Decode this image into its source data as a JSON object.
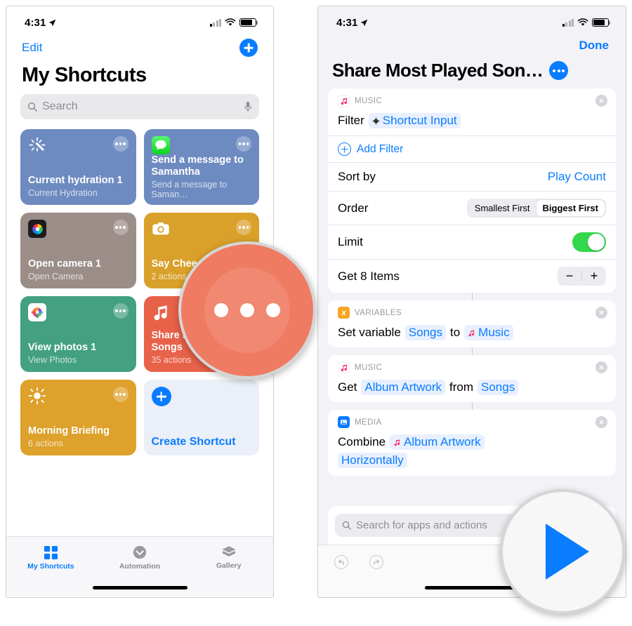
{
  "left_phone": {
    "status": {
      "time": "4:31",
      "location_icon": "location-arrow-icon",
      "signal_icon": "cellular-bars-icon",
      "wifi_icon": "wifi-icon",
      "battery_icon": "battery-icon"
    },
    "nav": {
      "edit_label": "Edit",
      "add_icon": "plus-circle-icon"
    },
    "title": "My Shortcuts",
    "search": {
      "placeholder": "Search",
      "icon": "search-icon",
      "mic_icon": "microphone-icon"
    },
    "cards": [
      {
        "name": "Current hydration 1",
        "sub": "Current Hydration",
        "color": "#6e8bc1",
        "glyph": "sparkle-wand-icon",
        "menu_icon": "ellipsis-icon"
      },
      {
        "name": "Send a message to Samantha",
        "sub": "Send a message to Saman…",
        "color": "#6e8bc1",
        "glyph": "messages-app-icon",
        "menu_icon": "ellipsis-icon"
      },
      {
        "name": "Open camera 1",
        "sub": "Open Camera",
        "color": "#9b8d88",
        "glyph": "camera-app-icon",
        "menu_icon": "ellipsis-icon"
      },
      {
        "name": "Say Cheese",
        "sub": "2 actions",
        "color": "#d9a02a",
        "glyph": "camera-icon",
        "menu_icon": "ellipsis-icon"
      },
      {
        "name": "View photos 1",
        "sub": "View Photos",
        "color": "#43a080",
        "glyph": "photos-app-icon",
        "menu_icon": "ellipsis-icon"
      },
      {
        "name": "Share Most Played Songs",
        "sub": "35 actions",
        "color": "#e8624a",
        "glyph": "music-note-icon",
        "menu_icon": "ellipsis-icon"
      },
      {
        "name": "Morning Briefing",
        "sub": "6 actions",
        "color": "#dda12c",
        "glyph": "sun-icon",
        "menu_icon": "ellipsis-icon"
      }
    ],
    "create_card": {
      "label": "Create Shortcut",
      "icon": "plus-circle-icon",
      "bg": "#eaeff8",
      "accent": "#0a7cff"
    },
    "tabs": [
      {
        "label": "My Shortcuts",
        "icon": "grid-squares-icon",
        "active": true
      },
      {
        "label": "Automation",
        "icon": "clock-automation-icon",
        "active": false
      },
      {
        "label": "Gallery",
        "icon": "layers-icon",
        "active": false
      }
    ]
  },
  "right_phone": {
    "status": {
      "time": "4:31",
      "location_icon": "location-arrow-icon",
      "signal_icon": "cellular-bars-icon",
      "wifi_icon": "wifi-icon",
      "battery_icon": "battery-icon"
    },
    "nav": {
      "done_label": "Done"
    },
    "title": "Share Most Played Son…",
    "title_menu_icon": "ellipsis-circle-icon",
    "action_cards": [
      {
        "category": "MUSIC",
        "icon": "music-app-icon",
        "icon_bg": "#ffffff",
        "close_icon": "close-icon",
        "main_label": "Filter",
        "main_token": "Shortcut Input",
        "token_icon": "shortcut-input-icon",
        "add_filter_label": "Add Filter",
        "add_filter_icon": "plus-circle-outline-icon",
        "rows": [
          {
            "label": "Sort by",
            "value": "Play Count",
            "kind": "link"
          },
          {
            "label": "Order",
            "kind": "segmented",
            "options": [
              "Smallest First",
              "Biggest First"
            ],
            "selected": "Biggest First"
          },
          {
            "label": "Limit",
            "kind": "toggle",
            "on": true
          },
          {
            "label": "Get 8 Items",
            "kind": "stepper",
            "minus": "−",
            "plus": "+"
          }
        ]
      },
      {
        "category": "VARIABLES",
        "icon": "variable-x-icon",
        "icon_bg": "#f5a623",
        "close_icon": "close-icon",
        "segments": [
          {
            "text": "Set variable",
            "type": "plain"
          },
          {
            "text": "Songs",
            "type": "token"
          },
          {
            "text": "to",
            "type": "plain"
          },
          {
            "text": "Music",
            "type": "token",
            "icon": "music-note-icon"
          }
        ]
      },
      {
        "category": "MUSIC",
        "icon": "music-app-icon",
        "icon_bg": "#ffffff",
        "close_icon": "close-icon",
        "segments": [
          {
            "text": "Get",
            "type": "plain"
          },
          {
            "text": "Album Artwork",
            "type": "token"
          },
          {
            "text": "from",
            "type": "plain"
          },
          {
            "text": "Songs",
            "type": "token"
          }
        ]
      },
      {
        "category": "MEDIA",
        "icon": "media-photo-icon",
        "icon_bg": "#0a7cff",
        "close_icon": "close-icon",
        "segments": [
          {
            "text": "Combine",
            "type": "plain"
          },
          {
            "text": "Album Artwork",
            "type": "token",
            "icon": "music-note-icon"
          },
          {
            "text": "Horizontally",
            "type": "token"
          }
        ]
      }
    ],
    "search": {
      "placeholder": "Search for apps and actions",
      "icon": "search-icon"
    },
    "toolbar": {
      "undo_icon": "undo-icon",
      "redo_icon": "redo-icon"
    }
  },
  "callouts": [
    {
      "name": "ellipsis-button-magnifier",
      "kind": "ellipsis",
      "bg": "#ef7b63",
      "dot_color": "#ffffff"
    },
    {
      "name": "play-button-magnifier",
      "kind": "play",
      "bg": "#f7f7f7",
      "tri_color": "#0a7cff"
    }
  ]
}
